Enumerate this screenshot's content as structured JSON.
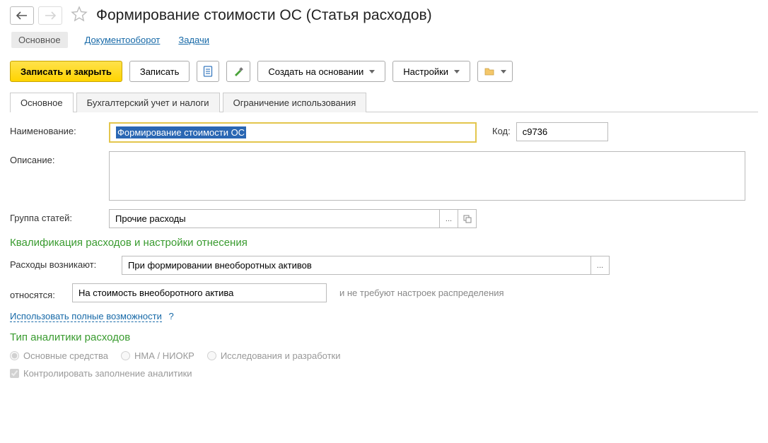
{
  "header": {
    "title": "Формирование стоимости ОС (Статья расходов)"
  },
  "linkbar": {
    "main": "Основное",
    "docflow": "Документооборот",
    "tasks": "Задачи"
  },
  "toolbar": {
    "save_close": "Записать и закрыть",
    "save": "Записать",
    "create_based": "Создать на основании",
    "settings": "Настройки"
  },
  "tabs": {
    "main": "Основное",
    "accounting": "Бухгалтерский учет и налоги",
    "restriction": "Ограничение использования"
  },
  "form": {
    "name_label": "Наименование:",
    "name_value": "Формирование стоимости ОС",
    "code_label": "Код:",
    "code_value": "с9736",
    "desc_label": "Описание:",
    "desc_value": "",
    "group_label": "Группа статей:",
    "group_value": "Прочие расходы"
  },
  "section1": {
    "title": "Квалификация расходов и настройки отнесения",
    "arise_label": "Расходы возникают:",
    "arise_value": "При формировании внеоборотных активов",
    "relate_label": "относятся:",
    "relate_value": "На стоимость внеоборотного актива",
    "hint": "и не требуют настроек распределения",
    "full_link": "Использовать полные возможности",
    "q": "?"
  },
  "section2": {
    "title": "Тип аналитики расходов",
    "radio1": "Основные средства",
    "radio2": "НМА / НИОКР",
    "radio3": "Исследования и разработки",
    "check": "Контролировать заполнение аналитики"
  }
}
